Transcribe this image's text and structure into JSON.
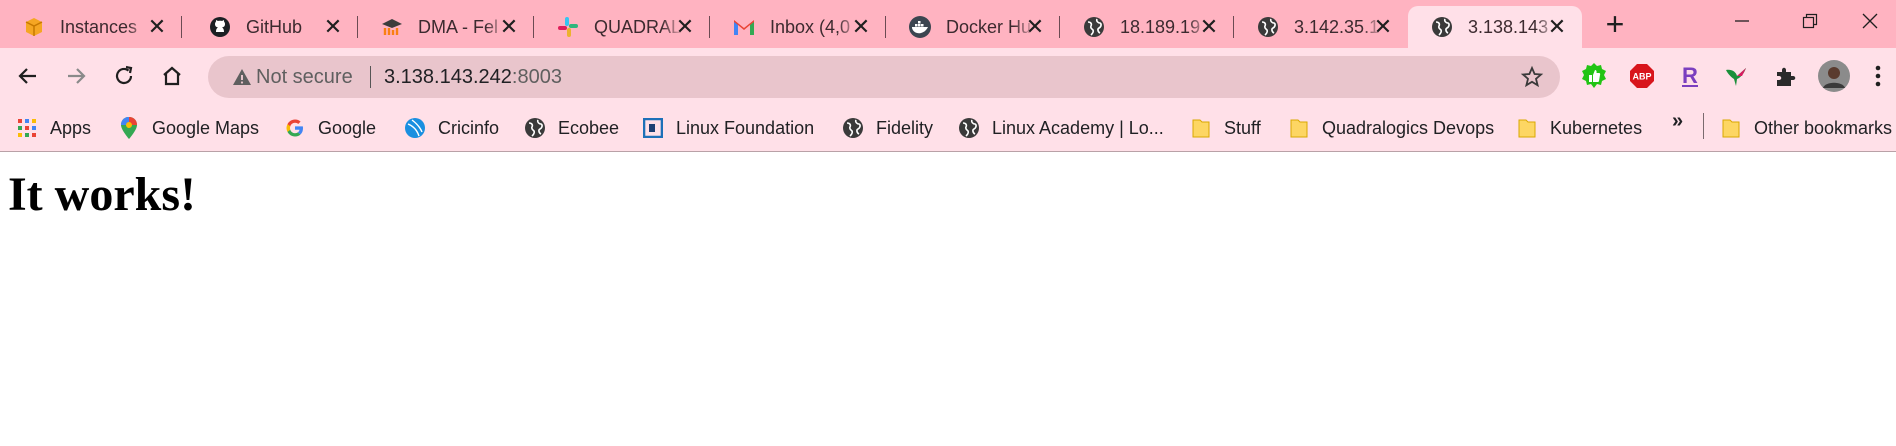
{
  "tabs": [
    {
      "title": "Instances",
      "icon": "aws-box-icon"
    },
    {
      "title": "GitHub",
      "icon": "github-icon"
    },
    {
      "title": "DMA - Fel",
      "icon": "moodle-icon"
    },
    {
      "title": "QUADRAL",
      "icon": "slack-icon"
    },
    {
      "title": "Inbox (4,0",
      "icon": "gmail-icon"
    },
    {
      "title": "Docker Hu",
      "icon": "docker-icon"
    },
    {
      "title": "18.189.19",
      "icon": "globe-icon"
    },
    {
      "title": "3.142.35.1",
      "icon": "globe-icon"
    },
    {
      "title": "3.138.143",
      "icon": "globe-icon",
      "active": true
    }
  ],
  "address_bar": {
    "security_label": "Not secure",
    "url_host": "3.138.143.242",
    "url_port": ":8003"
  },
  "bookmarks": [
    {
      "label": "Apps",
      "icon": "apps-grid-icon"
    },
    {
      "label": "Google Maps",
      "icon": "google-maps-icon"
    },
    {
      "label": "Google",
      "icon": "google-icon"
    },
    {
      "label": "Cricinfo",
      "icon": "cricinfo-icon"
    },
    {
      "label": "Ecobee",
      "icon": "globe-icon"
    },
    {
      "label": "Linux Foundation",
      "icon": "linux-foundation-icon"
    },
    {
      "label": "Fidelity",
      "icon": "globe-icon"
    },
    {
      "label": "Linux Academy | Lo...",
      "icon": "globe-icon"
    },
    {
      "label": "Stuff",
      "icon": "folder-icon"
    },
    {
      "label": "Quadralogics Devops",
      "icon": "folder-icon"
    },
    {
      "label": "Kubernetes",
      "icon": "folder-icon"
    }
  ],
  "bookmarks_overflow": "»",
  "other_bookmarks": "Other bookmarks",
  "page": {
    "heading": "It works!"
  },
  "colors": {
    "tabstrip": "#ffb3c1",
    "toolbar": "#ffe0e8",
    "omnibox": "#e9c5cc"
  }
}
